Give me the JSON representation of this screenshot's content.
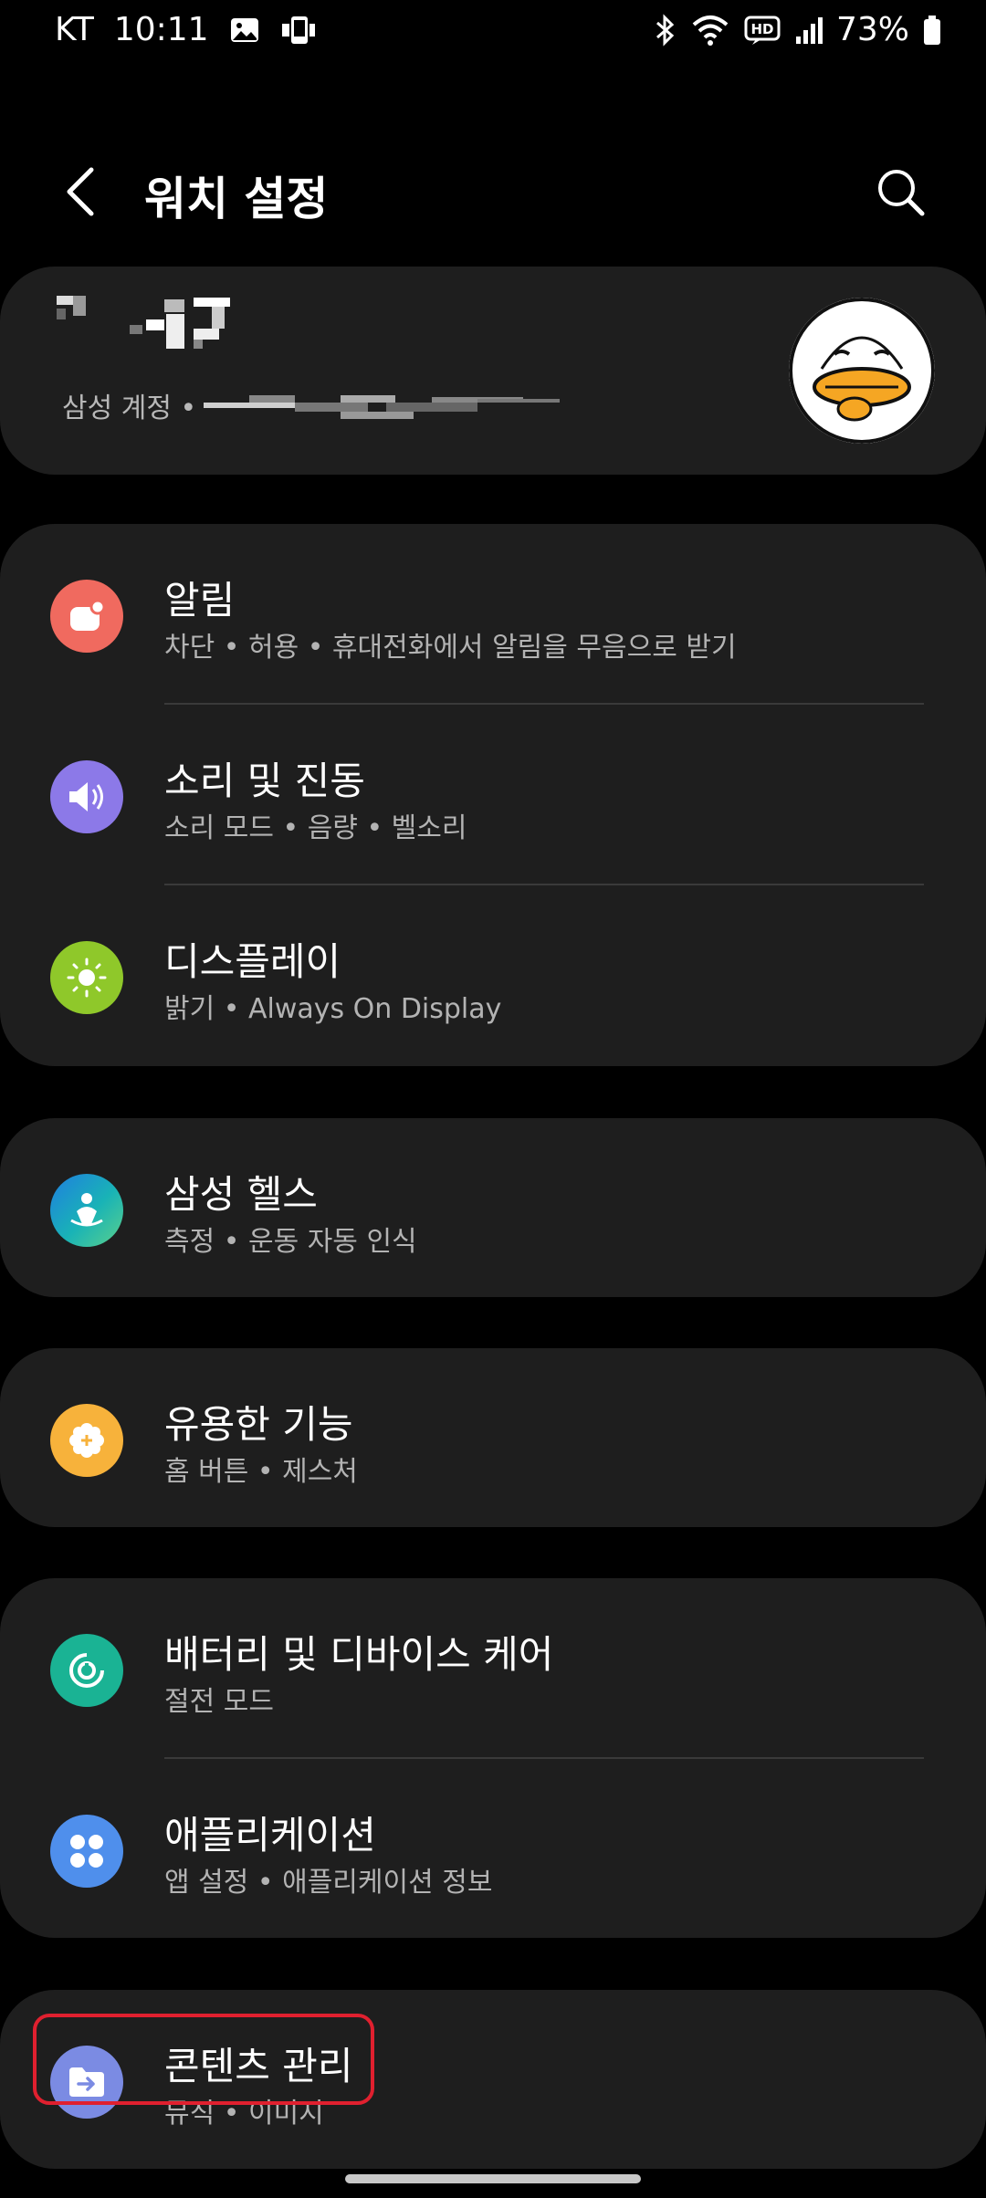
{
  "status_bar": {
    "carrier": "KT",
    "time": "10:11",
    "battery": "73%",
    "hd_label": "HD"
  },
  "header": {
    "title": "워치 설정"
  },
  "account": {
    "label": "삼성 계정 •"
  },
  "groups": [
    {
      "items": [
        {
          "title": "알림",
          "subtitle": "차단 • 허용 • 휴대전화에서 알림을 무음으로 받기",
          "icon": "notification-icon",
          "color": "#f06a5f"
        },
        {
          "title": "소리 및 진동",
          "subtitle": "소리 모드 • 음량 • 벨소리",
          "icon": "speaker-icon",
          "color": "#8c79e8"
        },
        {
          "title": "디스플레이",
          "subtitle": "밝기 • Always On Display",
          "icon": "sun-icon",
          "color": "#8fc82a"
        }
      ]
    },
    {
      "items": [
        {
          "title": "삼성 헬스",
          "subtitle": "측정 • 운동 자동 인식",
          "icon": "health-icon",
          "color": "#19b3b6"
        }
      ]
    },
    {
      "items": [
        {
          "title": "유용한 기능",
          "subtitle": "홈 버튼 • 제스처",
          "icon": "gear-plus-icon",
          "color": "#f7b23b"
        }
      ]
    },
    {
      "items": [
        {
          "title": "배터리 및 디바이스 케어",
          "subtitle": "절전 모드",
          "icon": "device-care-icon",
          "color": "#1ab394"
        },
        {
          "title": "애플리케이션",
          "subtitle": "앱 설정 • 애플리케이션 정보",
          "icon": "apps-icon",
          "color": "#4f8fec"
        }
      ]
    },
    {
      "items": [
        {
          "title": "콘텐츠 관리",
          "subtitle": "뮤직 • 이미지",
          "icon": "folder-arrow-icon",
          "color": "#7b8be3"
        }
      ]
    }
  ]
}
